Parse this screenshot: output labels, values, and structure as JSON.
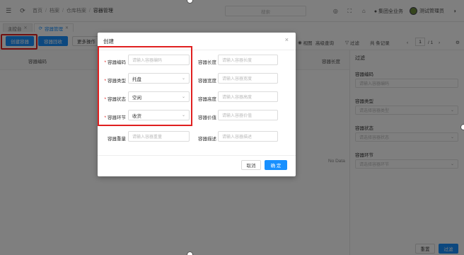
{
  "header": {
    "breadcrumb": [
      "首页",
      "档案",
      "仓库档案",
      "容器管理"
    ],
    "search_placeholder": "搜索",
    "org_name": "集团全业务",
    "user_name": "测试管理员"
  },
  "tabs": [
    {
      "label": "主控台",
      "active": false
    },
    {
      "label": "容器管理",
      "active": true
    }
  ],
  "toolbar": {
    "create_label": "创建容器",
    "recycle_label": "容器回收",
    "more_label": "更多操作",
    "view_label": "视图",
    "advanced_label": "高级查询",
    "filter_label": "过滤",
    "records_label": "共 条记录",
    "page_current": "1",
    "page_sep": "/ 1"
  },
  "grid": {
    "columns": [
      "容器编码",
      "容器长度"
    ],
    "no_data": "No Data"
  },
  "filter_panel": {
    "title": "过滤",
    "fields": [
      {
        "label": "容器编码",
        "placeholder": "请输入容器编码",
        "select": false
      },
      {
        "label": "容器类型",
        "placeholder": "请选择容器类型",
        "select": true
      },
      {
        "label": "容器状态",
        "placeholder": "请选择容器状态",
        "select": true
      },
      {
        "label": "容器环节",
        "placeholder": "请选择容器环节",
        "select": true
      }
    ],
    "reset_label": "重置",
    "filter_label": "过滤"
  },
  "modal": {
    "title": "创建",
    "left_fields": [
      {
        "label": "容器编码",
        "required": true,
        "value": "",
        "placeholder": "请输入容器编码",
        "select": false
      },
      {
        "label": "容器类型",
        "required": true,
        "value": "托盘",
        "placeholder": "",
        "select": true
      },
      {
        "label": "容器状态",
        "required": true,
        "value": "空闲",
        "placeholder": "",
        "select": true
      },
      {
        "label": "容器环节",
        "required": true,
        "value": "收货",
        "placeholder": "",
        "select": true
      },
      {
        "label": "容器重量",
        "required": false,
        "value": "",
        "placeholder": "请输入容器重量",
        "select": false
      }
    ],
    "right_fields": [
      {
        "label": "容器长度",
        "placeholder": "请输入容器长度"
      },
      {
        "label": "容器宽度",
        "placeholder": "请输入容器宽度"
      },
      {
        "label": "容器高度",
        "placeholder": "请输入容器高度"
      },
      {
        "label": "容器价值",
        "placeholder": "请输入容器价值"
      },
      {
        "label": "容器描述",
        "placeholder": "请输入容器描述"
      }
    ],
    "cancel_label": "取消",
    "ok_label": "确 定"
  },
  "colors": {
    "primary": "#1890ff",
    "highlight": "#e02020",
    "required": "#e02020"
  }
}
